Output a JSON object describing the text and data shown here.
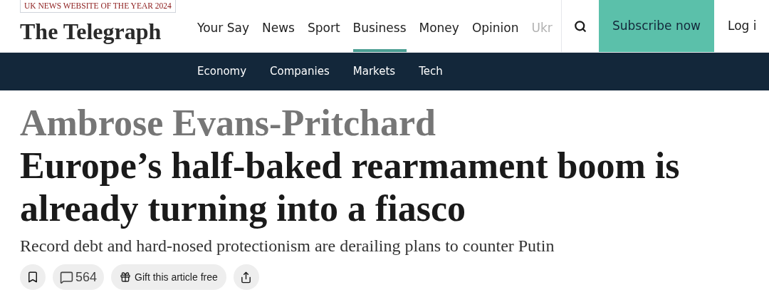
{
  "badge": "UK NEWS WEBSITE OF THE YEAR 2024",
  "logo": "The Telegraph",
  "nav": [
    {
      "label": "Your Say",
      "selected": false
    },
    {
      "label": "News",
      "selected": false
    },
    {
      "label": "Sport",
      "selected": false
    },
    {
      "label": "Business",
      "selected": true
    },
    {
      "label": "Money",
      "selected": false
    },
    {
      "label": "Opinion",
      "selected": false
    },
    {
      "label": "Ukr",
      "selected": false
    }
  ],
  "subscribe": "Subscribe now",
  "login": "Log i",
  "subnav": [
    "Economy",
    "Companies",
    "Markets",
    "Tech"
  ],
  "article": {
    "author": "Ambrose Evans-Pritchard",
    "headline": "Europe’s half-baked rearmament boom is already turning into a fiasco",
    "standfirst": "Record debt and hard-nosed protectionism are derailing plans to counter Putin",
    "comments": "564",
    "gift": "Gift this article free"
  }
}
